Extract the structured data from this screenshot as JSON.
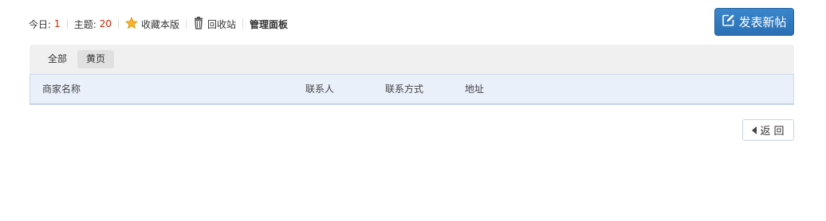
{
  "stats": {
    "today_label": "今日:",
    "today_count": "1",
    "topics_label": "主题:",
    "topics_count": "20"
  },
  "actions": {
    "favorite_label": "收藏本版",
    "recycle_label": "回收站",
    "admin_label": "管理面板",
    "post_label": "发表新帖",
    "back_label": "返 回"
  },
  "tabs": [
    {
      "label": "全部",
      "active": false
    },
    {
      "label": "黄页",
      "active": true
    }
  ],
  "table": {
    "columns": [
      "商家名称",
      "联系人",
      "联系方式",
      "地址"
    ]
  },
  "icons": {
    "favorite": "star-icon",
    "recycle": "trash-icon",
    "post": "edit-icon",
    "back": "caret-left-icon"
  },
  "colors": {
    "count": "#cc2200",
    "post_button": "#2a6fb3",
    "tabs_background": "#f0f0f0",
    "header_background": "#eaf0fa"
  }
}
